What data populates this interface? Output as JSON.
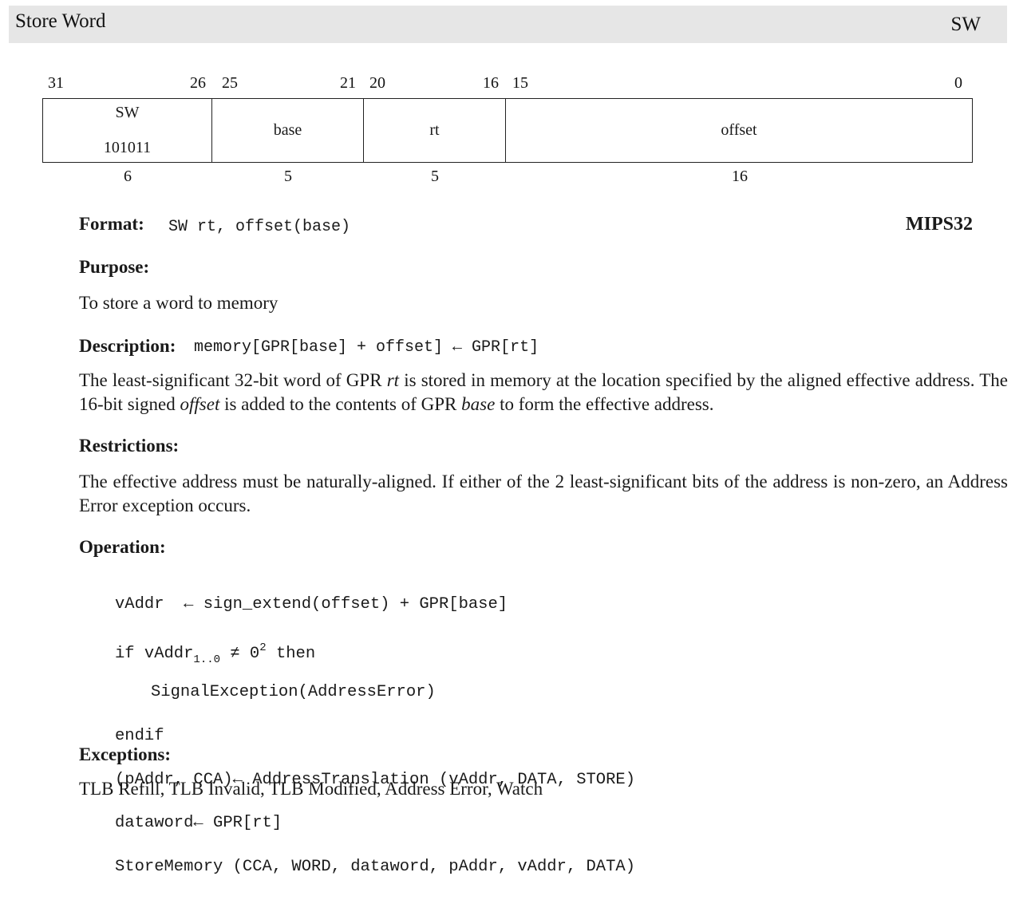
{
  "header": {
    "title": "Store Word",
    "mnemonic": "SW"
  },
  "encoding": {
    "bit_positions": [
      "31",
      "26",
      "25",
      "21",
      "20",
      "16",
      "15",
      "0"
    ],
    "fields": [
      {
        "name": "SW",
        "value": "101011",
        "width": "6"
      },
      {
        "name": "base",
        "width": "5"
      },
      {
        "name": "rt",
        "width": "5"
      },
      {
        "name": "offset",
        "width": "16"
      }
    ]
  },
  "format": {
    "label": "Format:",
    "syntax": "SW rt, offset(base)",
    "arch": "MIPS32"
  },
  "purpose": {
    "label": "Purpose:",
    "text": "To store a word to memory"
  },
  "description": {
    "label": "Description:",
    "code": "memory[GPR[base] + offset] ← GPR[rt]",
    "p1_a": "The least-significant 32-bit word of GPR ",
    "p1_rt": "rt",
    "p1_b": " is stored in memory at the location specified by the aligned effective address. The 16-bit signed ",
    "p1_offset": "offset",
    "p1_c": " is added to the contents of GPR ",
    "p1_base": "base",
    "p1_d": " to form the effective address."
  },
  "restrictions": {
    "label": "Restrictions:",
    "text": "The effective address must be naturally-aligned. If either of the 2 least-significant bits of the address is non-zero, an Address Error exception occurs."
  },
  "operation": {
    "label": "Operation:",
    "line1": "vAddr  ← sign_extend(offset) + GPR[base]",
    "line2_a": "if vAddr",
    "line2_sub": "1..0",
    "line2_b": " ≠ 0",
    "line2_sup": "2",
    "line2_c": " then",
    "line3": "SignalException(AddressError)",
    "line4": "endif",
    "line5": "(pAddr, CCA)← AddressTranslation (vAddr, DATA, STORE)",
    "line6": "dataword← GPR[rt]",
    "line7": "StoreMemory (CCA, WORD, dataword, pAddr, vAddr, DATA)"
  },
  "exceptions": {
    "label": "Exceptions:",
    "text": "TLB Refill, TLB Invalid, TLB Modified, Address Error, Watch"
  }
}
